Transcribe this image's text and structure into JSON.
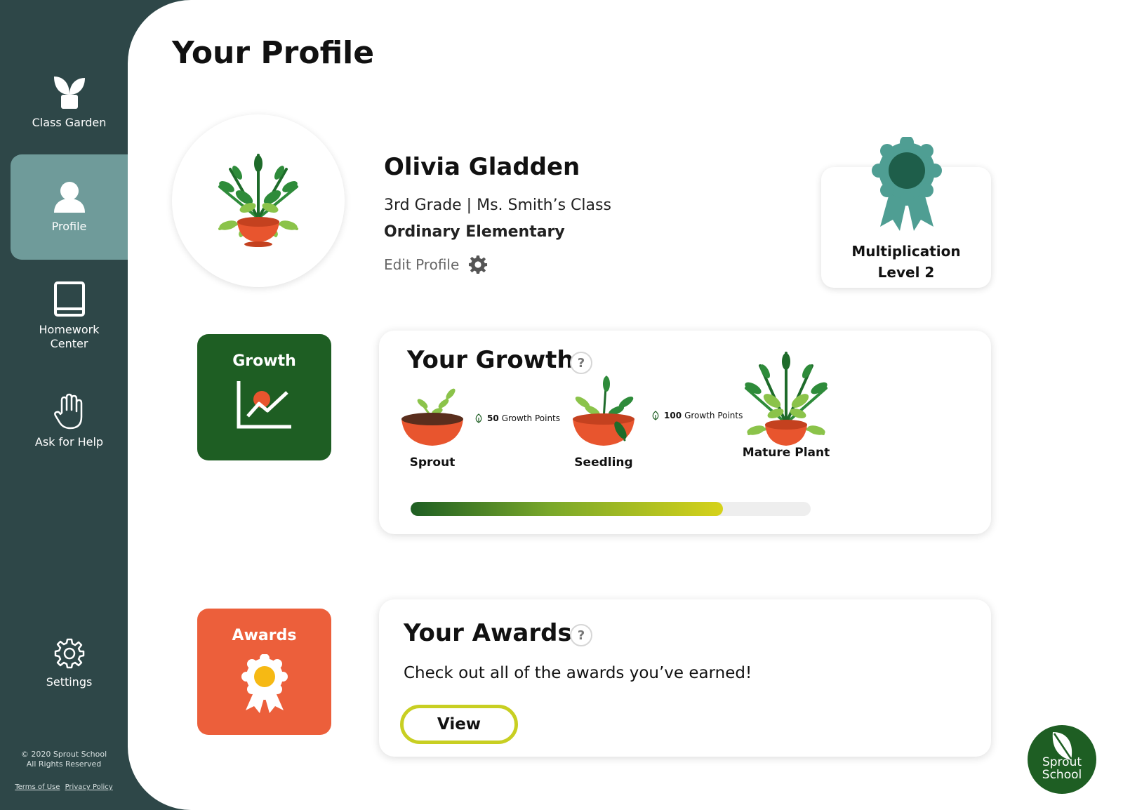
{
  "sidebar": {
    "items": [
      {
        "label": "Class Garden",
        "icon": "plant-icon",
        "active": false
      },
      {
        "label": "Profile",
        "icon": "person-icon",
        "active": true
      },
      {
        "label": "Homework\nCenter",
        "icon": "book-icon",
        "active": false
      },
      {
        "label": "Ask for Help",
        "icon": "hand-icon",
        "active": false
      },
      {
        "label": "Settings",
        "icon": "gear-icon",
        "active": false
      }
    ],
    "copyright_line1": "© 2020 Sprout School",
    "copyright_line2": "All Rights Reserved",
    "terms": "Terms of Use",
    "privacy": "Privacy Policy"
  },
  "page": {
    "title": "Your Profile"
  },
  "student": {
    "name": "Olivia Gladden",
    "grade_class": "3rd Grade | Ms. Smith’s Class",
    "school": "Ordinary Elementary",
    "edit_label": "Edit Profile"
  },
  "badge": {
    "line1": "Multiplication",
    "line2": "Level 2"
  },
  "tiles": {
    "growth": "Growth",
    "awards": "Awards"
  },
  "growth": {
    "title": "Your Growth",
    "help": "?",
    "stages": [
      {
        "label": "Sprout"
      },
      {
        "label": "Seedling"
      },
      {
        "label": "Mature Plant"
      }
    ],
    "thresholds": [
      {
        "points": "50",
        "unit": "Growth Points"
      },
      {
        "points": "100",
        "unit": "Growth Points"
      }
    ],
    "progress": 0.78
  },
  "awards": {
    "title": "Your Awards",
    "help": "?",
    "description": "Check out all of the awards you’ve earned!",
    "view_label": "View"
  },
  "brand": {
    "line1": "Sprout",
    "line2": "School"
  },
  "colors": {
    "sidebar": "#2e4748",
    "active": "#6f9b9a",
    "growth_tile": "#1e5e23",
    "awards_tile": "#ec5f3b",
    "badge": "#4f9e93",
    "view_border": "#c8cf22"
  }
}
